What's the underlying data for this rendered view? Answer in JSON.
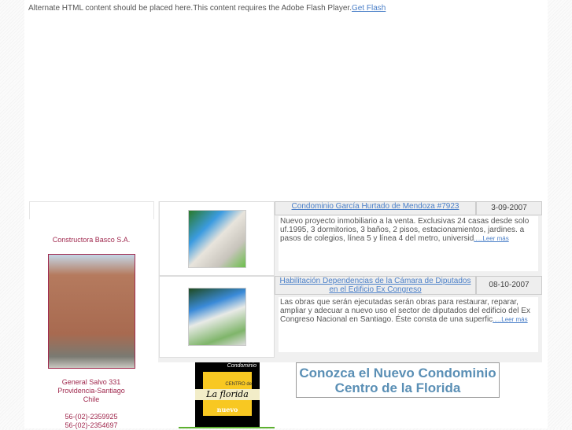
{
  "flash": {
    "text": "Alternate HTML content should be placed here.This content requires the Adobe Flash Player.",
    "link": "Get Flash"
  },
  "company": {
    "name": "Constructora Basco S.A.",
    "address1": "General Salvo 331",
    "address2": "Providencia-Santiago",
    "address3": "Chile",
    "phone1": "56-(02)-2359925",
    "phone2": "56-(02)-2354697"
  },
  "news": [
    {
      "title": "Condominio García Hurtado de Mendoza #7923",
      "date": "3-09-2007",
      "body": "Nuevo proyecto inmobiliario a la venta. Exclusivas 24 casas desde solo uf.1995, 3 dormitorios, 3 baños, 2 pisos, estacionamientos, jardines. a pasos de colegios, línea 5 y línea 4 del metro, universid",
      "more": ".....Leer más"
    },
    {
      "title": "Habilitación Dependencias de la Cámara de Diputados en el Edificio Ex Congreso",
      "date": "08-10-2007",
      "body": "Las obras que serán ejecutadas serán obras para restaurar, reparar, ampliar y adecuar a nuevo uso el sector de diputados del edificio del Ex Congreso Nacional en Santiago. Éste consta de una superfic",
      "more": ".....Leer más"
    }
  ],
  "promo": {
    "logo_top": "Condominio",
    "logo_mid": "CENTRO de",
    "logo_name": "La florida",
    "logo_bottom": "nuevo",
    "cta": "Conozca el Nuevo Condominio Centro de la Florida"
  }
}
